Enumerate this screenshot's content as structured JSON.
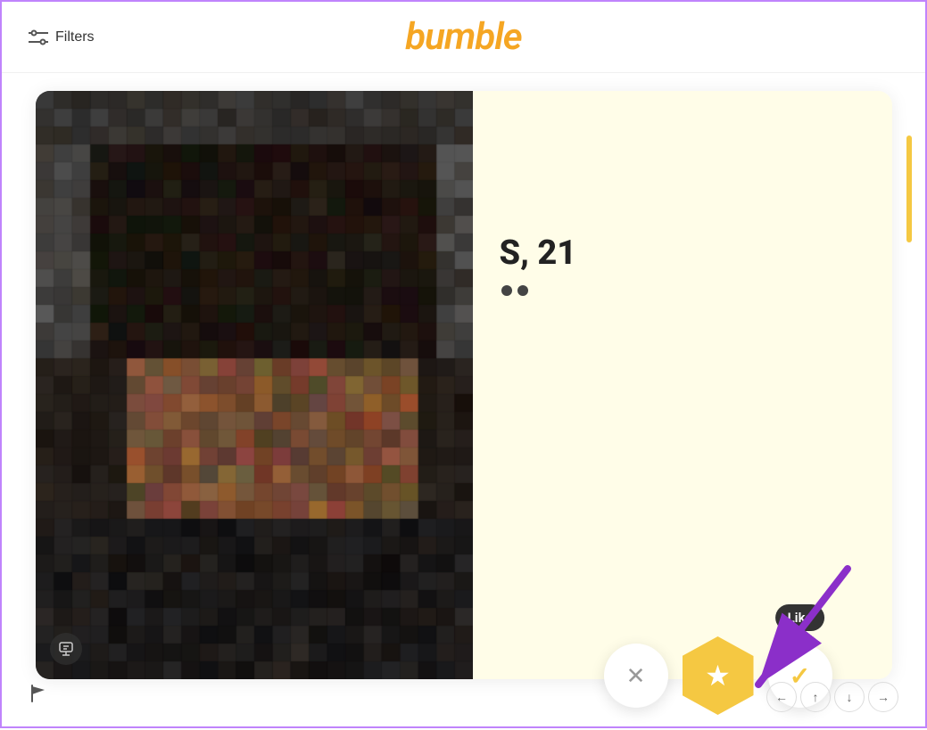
{
  "header": {
    "logo": "bumble",
    "filters_label": "Filters"
  },
  "card": {
    "profile_name": "S, 21",
    "like_tooltip": "Like"
  },
  "buttons": {
    "pass_label": "✕",
    "superlike_label": "★",
    "like_label": "✓"
  },
  "nav": {
    "left": "←",
    "up": "↑",
    "down": "↓",
    "right": "→"
  },
  "colors": {
    "brand_yellow": "#f5c842",
    "brand_yellow_light": "#fffde8",
    "purple_arrow": "#8b2fc9",
    "scroll_indicator": "#f5c842"
  },
  "pixels": [
    "#2d2d2d",
    "#353535",
    "#3a3a3a",
    "#404040",
    "#383838",
    "#3c3c3c",
    "#444",
    "#424242",
    "#3e3e3e",
    "#3a3a3a",
    "#353535",
    "#2e2e2e",
    "#333",
    "#3b3b3b",
    "#424242",
    "#454545",
    "#3d3d3d",
    "#383838",
    "#323232",
    "#2d2d2d",
    "#303030",
    "#3a3a3a",
    "#424242",
    "#454545",
    "#303030",
    "#382820",
    "#3d2e22",
    "#402d20",
    "#3a2c20",
    "#35281c",
    "#452e22",
    "#4a3025",
    "#3e2d22",
    "#38281c",
    "#30261a",
    "#2a2218",
    "#2e2818",
    "#38281c",
    "#3e2e22",
    "#45302a",
    "#4a3228",
    "#422e24",
    "#3a2820",
    "#342418",
    "#2e2218",
    "#2e2a1e",
    "#383028",
    "#413832",
    "#2a2018",
    "#5a3820",
    "#6a4028",
    "#6e4228",
    "#683e24",
    "#5e381e",
    "#7a4830",
    "#8a5035",
    "#7a4830",
    "#6a4028",
    "#5a3820",
    "#4e3018",
    "#503018",
    "#5a3820",
    "#6a4028",
    "#7e4a30",
    "#8a5238",
    "#7e4c32",
    "#6a4028",
    "#5a3820",
    "#4e2e18",
    "#4a2e18",
    "#5e3820",
    "#6a4030",
    "#241c14",
    "#7a5030",
    "#8a5835",
    "#8c5a36",
    "#865634",
    "#7a4e2c",
    "#9a6040",
    "#a86848",
    "#9a6040",
    "#8a5838",
    "#7a5030",
    "#6a4828",
    "#6a4828",
    "#7a5030",
    "#8a5838",
    "#9a6040",
    "#a86848",
    "#9a6040",
    "#8a5838",
    "#7a5030",
    "#6a4828",
    "#624820",
    "#785038",
    "#845840",
    "#201810",
    "#6a4828",
    "#7a5030",
    "#7c5232",
    "#765030",
    "#6a4828",
    "#8a5838",
    "#986040",
    "#8a5838",
    "#7a5030",
    "#6a4828",
    "#5a4020",
    "#5a4020",
    "#6a4828",
    "#7a5030",
    "#8a5838",
    "#986040",
    "#8a5838",
    "#7a5030",
    "#6a4828",
    "#5a4020",
    "#584018",
    "#6a4828",
    "#785030",
    "#2a2018",
    "#503820",
    "#5c4028",
    "#5e4228",
    "#584028",
    "#502e1c",
    "#6a4828",
    "#7a5030",
    "#6a4828",
    "#5a4020",
    "#503818",
    "#483018",
    "#483018",
    "#503820",
    "#5c4030",
    "#6a4828",
    "#7a5030",
    "#6e4c2c",
    "#5e4228",
    "#503818",
    "#483018",
    "#483018",
    "#543820",
    "#5c4028",
    "#181010",
    "#3a2818",
    "#483020",
    "#4a3220",
    "#443020",
    "#3e2a18",
    "#503820",
    "#5c4028",
    "#503820",
    "#443020",
    "#3c2818",
    "#382418",
    "#382418",
    "#3e2820",
    "#483020",
    "#503820",
    "#5c4028",
    "#543e28",
    "#4a3020",
    "#3e2a18",
    "#382418",
    "#382018",
    "#3e2c20",
    "#483020",
    "#100c08",
    "#302018",
    "#382818",
    "#3c2a1c",
    "#382818",
    "#322018",
    "#403028",
    "#4a3828",
    "#443020",
    "#3a2820",
    "#302018",
    "#2c1c10",
    "#2c1c10",
    "#302018",
    "#382820",
    "#403028",
    "#4a3828",
    "#443028",
    "#3c2820",
    "#302018",
    "#2c1c10",
    "#2c1810",
    "#342020",
    "#382820",
    "#0c0808",
    "#201810",
    "#282010",
    "#2c2014",
    "#282010",
    "#221810",
    "#302018",
    "#383020",
    "#302818",
    "#282018",
    "#201810",
    "#1c1408",
    "#1c1408",
    "#201810",
    "#282018",
    "#302018",
    "#383020",
    "#342820",
    "#2c2018",
    "#221810",
    "#1c1408",
    "#1c1008",
    "#241810",
    "#282018"
  ]
}
